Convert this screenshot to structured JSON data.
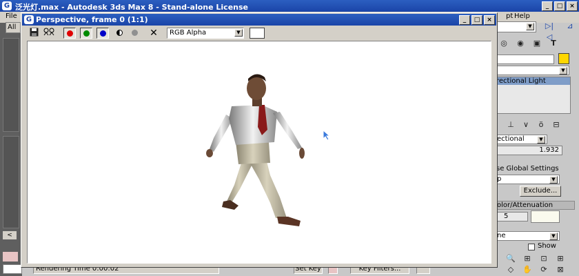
{
  "app": {
    "title": "泛光灯.max - Autodesk 3ds Max 8 - Stand-alone License",
    "menu": {
      "file": "File",
      "help": "Help",
      "script_fragment": "pt"
    },
    "filter_label": "All"
  },
  "frame_window": {
    "title": "Perspective, frame 0 (1:1)",
    "channel": "RGB Alpha",
    "toolbar": {
      "save": "save-icon",
      "clone": "clone-icon",
      "red": "#e00000",
      "green": "#008a00",
      "blue": "#0000c8",
      "alpha": "alpha-icon",
      "mono": "#909090",
      "clear": "clear-icon"
    }
  },
  "command_panel": {
    "object_type": "rectional Light",
    "light_type": "ectional",
    "multiplier": "1.932",
    "use_global": "se Global Settings",
    "shadow_type": "p",
    "exclude": "Exclude...",
    "rollout_color": "olor/Attenuation",
    "decay_value": "5",
    "decay_type": "ne",
    "show": "Show",
    "yellow": "#ffd700"
  },
  "status": {
    "render_time": "Rendering Time  0:00:02",
    "set_key": "Set Key",
    "key_filters": "Key Filters..."
  }
}
